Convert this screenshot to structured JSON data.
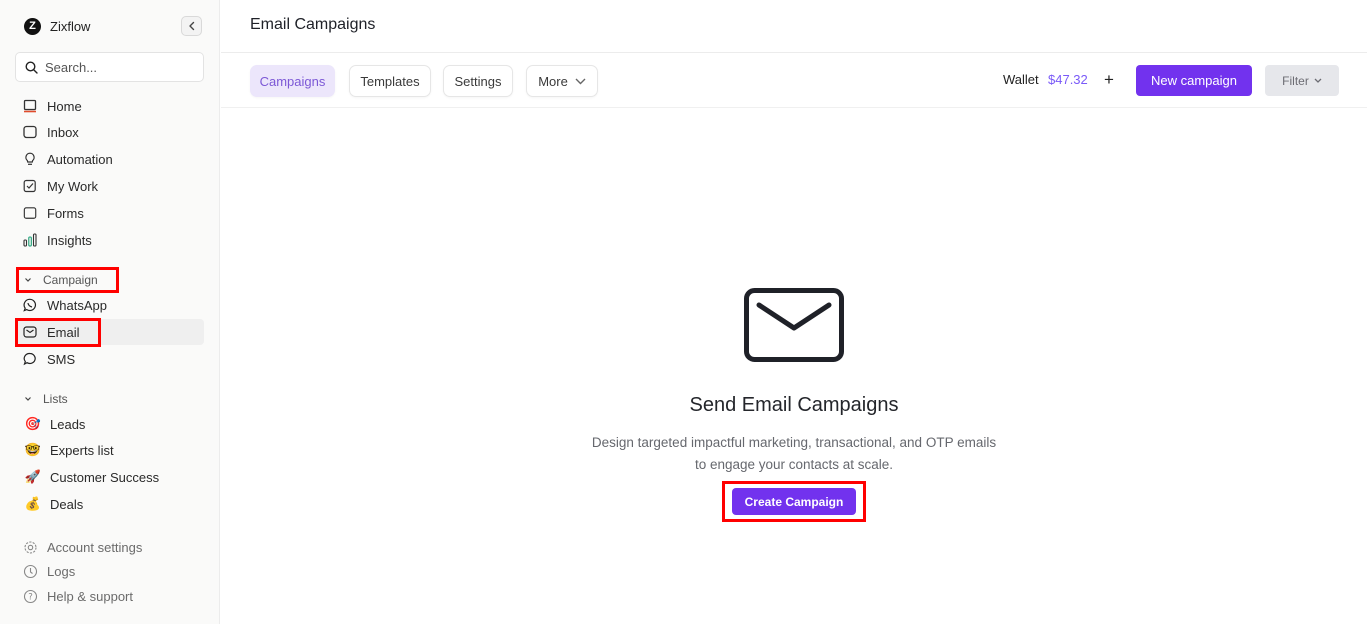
{
  "brand": {
    "logo_letter": "Z",
    "name": "Zixflow"
  },
  "search": {
    "placeholder": "Search..."
  },
  "nav": {
    "home": "Home",
    "inbox": "Inbox",
    "automation": "Automation",
    "my_work": "My Work",
    "forms": "Forms",
    "insights": "Insights"
  },
  "campaign_section": {
    "label": "Campaign",
    "items": {
      "whatsapp": "WhatsApp",
      "email": "Email",
      "sms": "SMS"
    }
  },
  "lists_section": {
    "label": "Lists",
    "items": {
      "leads": {
        "emoji": "🎯",
        "label": "Leads"
      },
      "experts": {
        "emoji": "🤓",
        "label": "Experts list"
      },
      "customer_success": {
        "emoji": "🚀",
        "label": "Customer Success"
      },
      "deals": {
        "emoji": "💰",
        "label": "Deals"
      }
    }
  },
  "footer_nav": {
    "account_settings": "Account settings",
    "logs": "Logs",
    "help_support": "Help & support"
  },
  "header": {
    "title": "Email Campaigns"
  },
  "tabs": {
    "campaigns": "Campaigns",
    "templates": "Templates",
    "settings": "Settings",
    "more": "More"
  },
  "wallet": {
    "label": "Wallet",
    "amount": "$47.32",
    "add_symbol": "+"
  },
  "actions": {
    "new_campaign": "New campaign",
    "filter": "Filter"
  },
  "empty_state": {
    "title": "Send Email Campaigns",
    "line1": "Design targeted impactful marketing, transactional, and OTP emails",
    "line2": "to engage your contacts at scale.",
    "cta": "Create Campaign"
  },
  "colors": {
    "accent": "#7232ee",
    "accent_soft": "#ece6fb",
    "highlight": "#ff0000"
  }
}
